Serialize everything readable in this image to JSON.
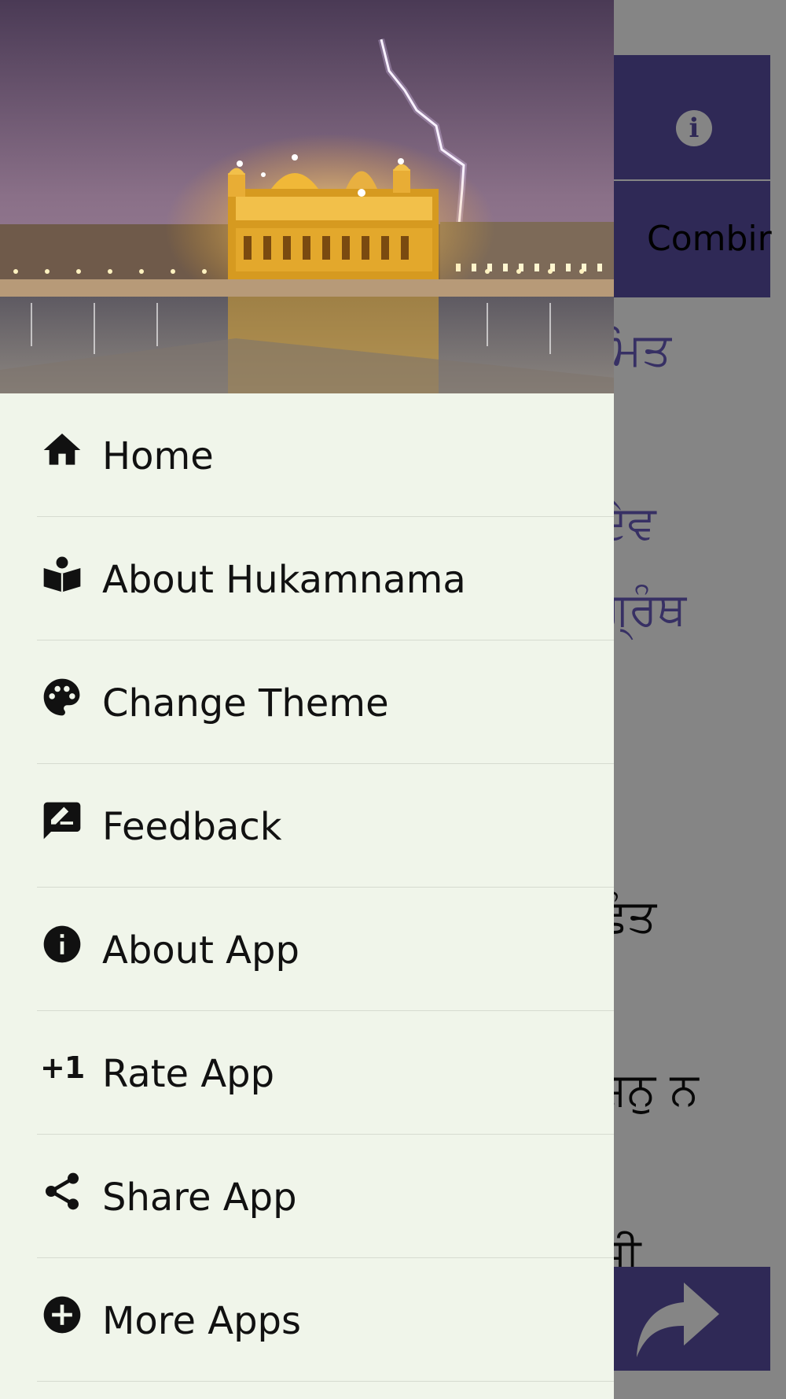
{
  "background_app": {
    "tab_partial_label": "Combir",
    "text_lines": [
      "ਮਿਤ",
      "ਦੇਵ",
      "ਗ੍ਰੰਥ",
      "।",
      "ਛੰਤ",
      "ਜ਼ਨੁ ਨ",
      "ਜੀ"
    ],
    "accent_color": "#5b4fa6"
  },
  "drawer": {
    "header_image": "golden-temple-lightning-photo",
    "background_color": "#f0f5ea",
    "items": [
      {
        "label": "Home",
        "icon": "home-icon"
      },
      {
        "label": "About Hukamnama",
        "icon": "book-reader-icon"
      },
      {
        "label": "Change Theme",
        "icon": "palette-icon"
      },
      {
        "label": "Feedback",
        "icon": "feedback-icon"
      },
      {
        "label": "About App",
        "icon": "info-icon"
      },
      {
        "label": "Rate App",
        "icon": "plus-one-icon",
        "icon_text": "+1"
      },
      {
        "label": "Share App",
        "icon": "share-icon"
      },
      {
        "label": "More Apps",
        "icon": "add-circle-icon"
      }
    ]
  }
}
